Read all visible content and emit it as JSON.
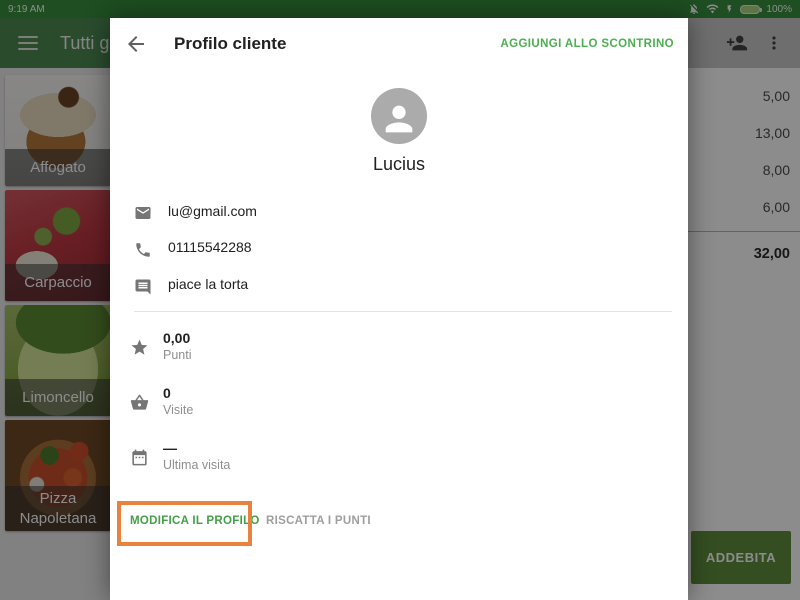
{
  "status_bar": {
    "time": "9:19 AM",
    "battery_level": "100%"
  },
  "app_toolbar": {
    "title": "Tutti gl"
  },
  "product_grid": {
    "items": [
      {
        "name": "Affogato"
      },
      {
        "name": "Carpaccio"
      },
      {
        "name": "Limoncello"
      },
      {
        "name": "Pizza Napoletana"
      }
    ]
  },
  "ticket": {
    "line_prices": [
      "5,00",
      "13,00",
      "8,00",
      "6,00"
    ],
    "total": "32,00",
    "charge_button": "ADDEBITA"
  },
  "profile_dialog": {
    "title": "Profilo cliente",
    "add_to_receipt_button": "AGGIUNGI ALLO SCONTRINO",
    "customer_name": "Lucius",
    "email": "lu@gmail.com",
    "phone": "01115542288",
    "note": "piace la torta",
    "stats": [
      {
        "value": "0,00",
        "label": "Punti",
        "icon": "star-icon"
      },
      {
        "value": "0",
        "label": "Visite",
        "icon": "basket-icon"
      },
      {
        "value": "—",
        "label": "Ultima visita",
        "icon": "calendar-icon"
      }
    ],
    "edit_profile_button": "MODIFICA IL PROFILO",
    "redeem_points_button": "RISCATTA I PUNTI"
  },
  "colors": {
    "accent_green": "#4CAF50",
    "toolbar_green": "#4E8A52",
    "status_bar_green": "#388E3C",
    "charge_button_green": "#5F8F3C",
    "highlight_orange": "#E8823C"
  }
}
